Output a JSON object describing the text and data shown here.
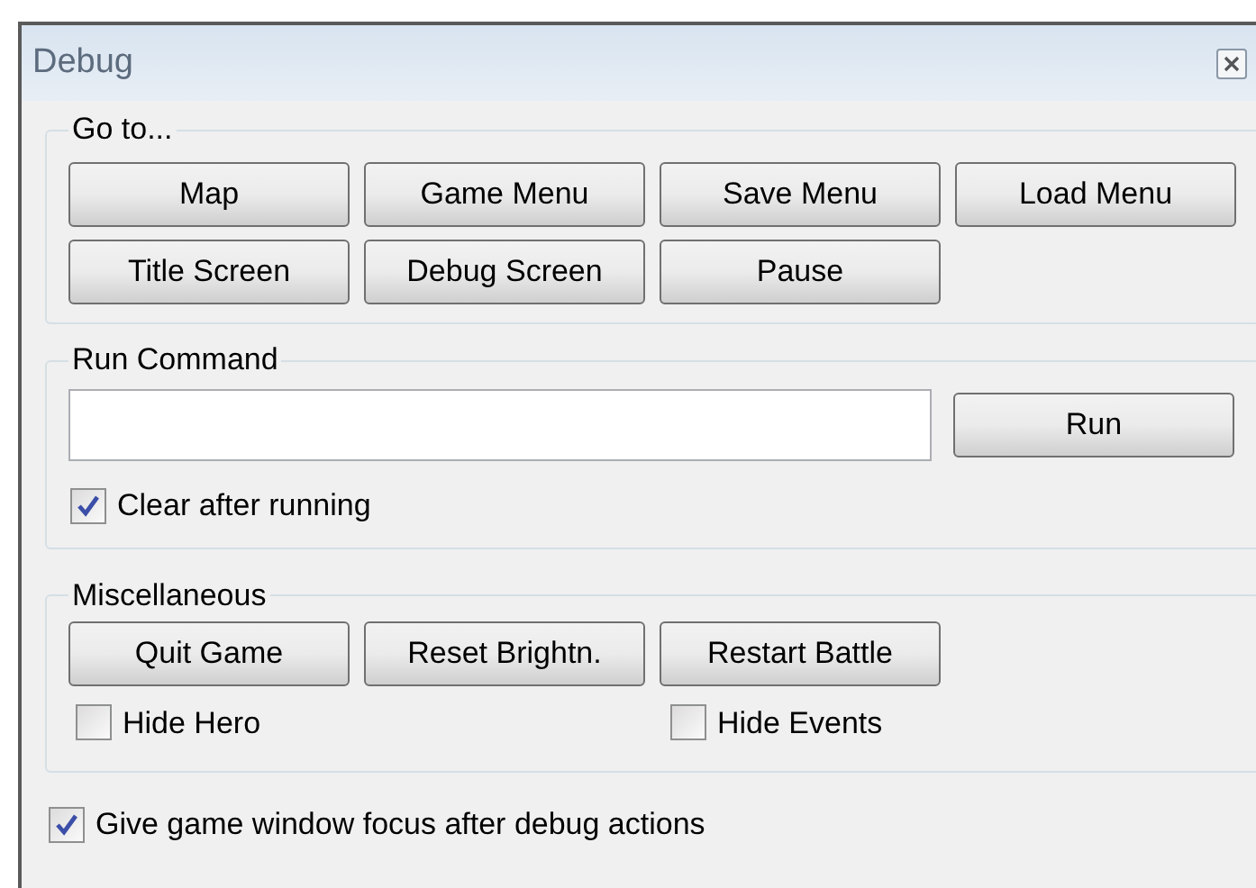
{
  "window": {
    "title": "Debug"
  },
  "goto": {
    "legend": "Go to...",
    "buttons": [
      "Map",
      "Game Menu",
      "Save Menu",
      "Load Menu",
      "Title Screen",
      "Debug Screen",
      "Pause"
    ]
  },
  "run_command": {
    "legend": "Run Command",
    "button": "Run",
    "clear_after": {
      "label": "Clear after running",
      "checked": true
    }
  },
  "misc": {
    "legend": "Miscellaneous",
    "buttons": [
      "Quit Game",
      "Reset Brightn.",
      "Restart Battle"
    ],
    "checkboxes": [
      {
        "label": "Hide Hero",
        "checked": false
      },
      {
        "label": "Hide Events",
        "checked": false
      }
    ]
  },
  "focus_option": {
    "label": "Give game window focus after debug actions",
    "checked": true
  }
}
